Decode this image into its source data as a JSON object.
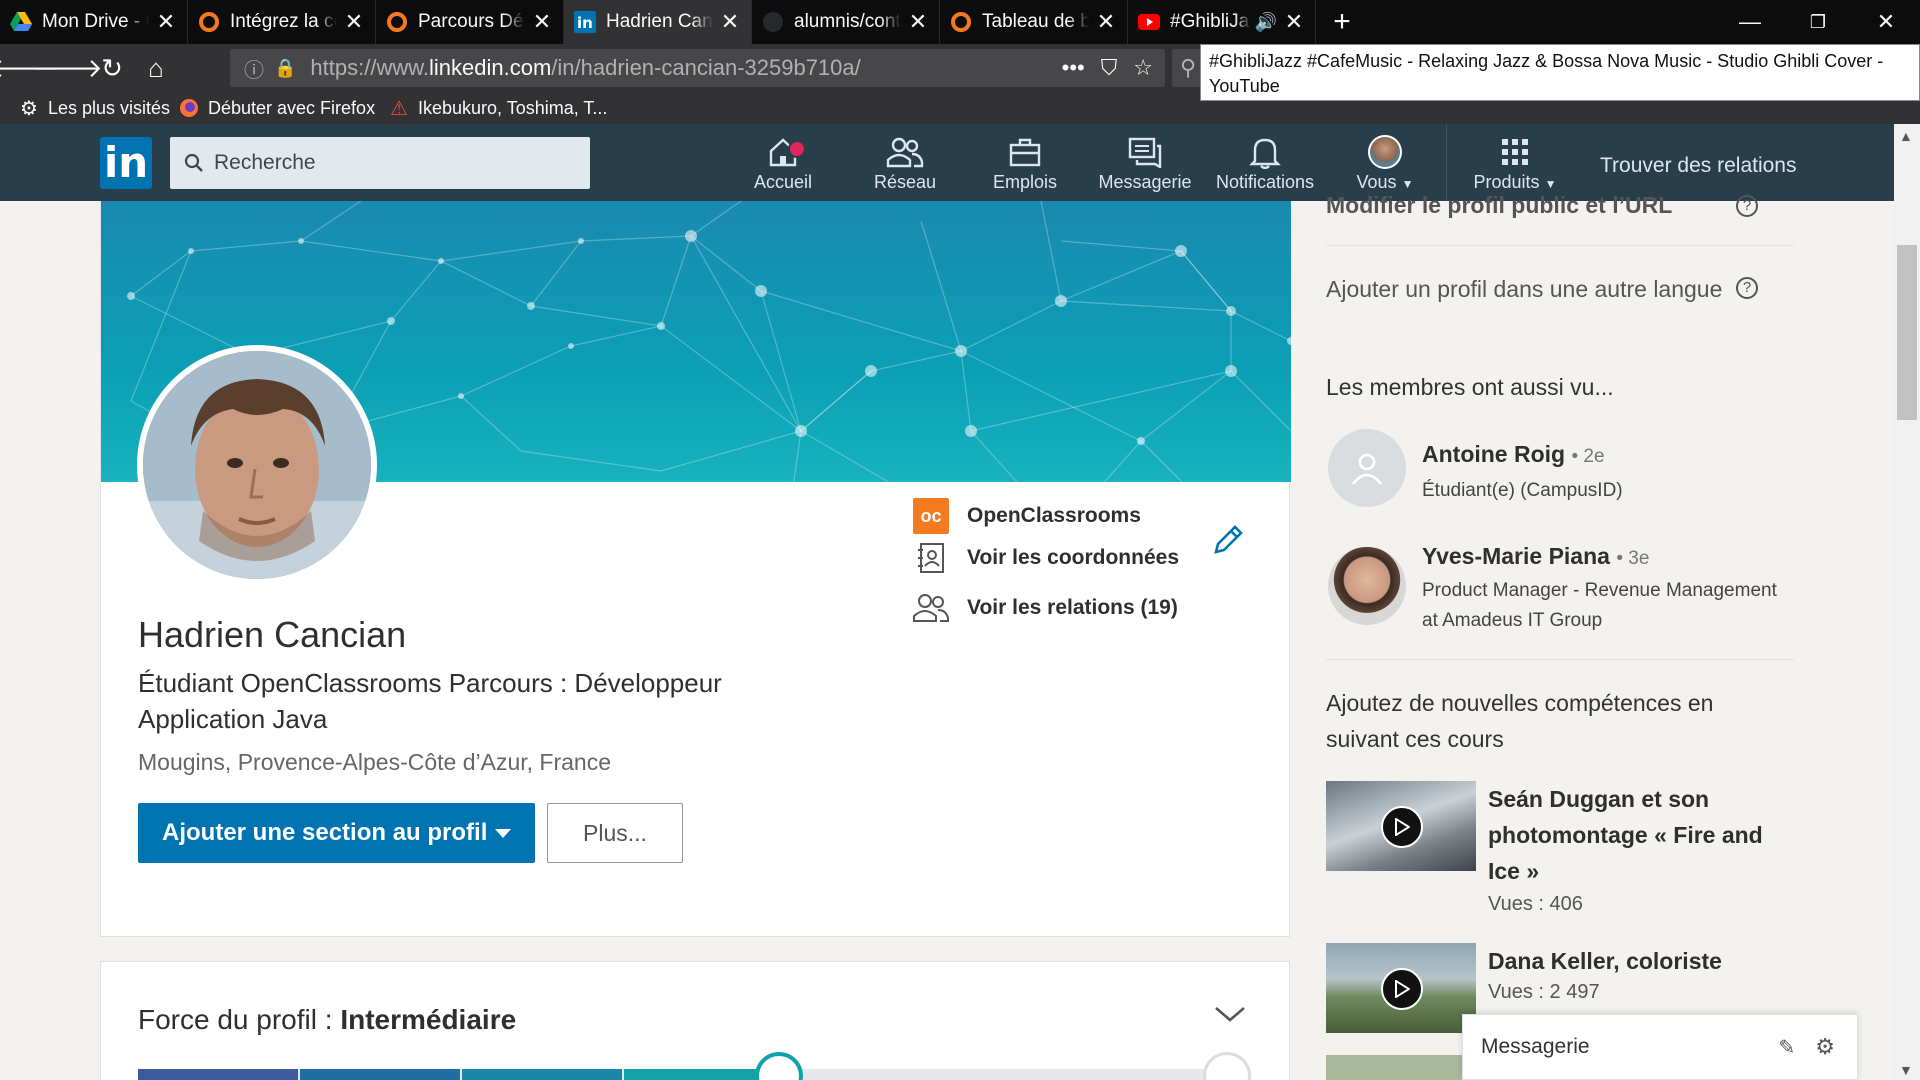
{
  "browser": {
    "tabs": [
      {
        "title": "Mon Drive - Google Drive",
        "icon": "google-drive-icon"
      },
      {
        "title": "Intégrez la communauté",
        "icon": "openclassrooms-icon"
      },
      {
        "title": "Parcours Développeur",
        "icon": "openclassrooms-icon"
      },
      {
        "title": "Hadrien Cancian | LinkedIn",
        "icon": "linkedin-icon"
      },
      {
        "title": "alumnis/content/",
        "icon": "github-icon"
      },
      {
        "title": "Tableau de bord",
        "icon": "openclassrooms-icon"
      },
      {
        "title": "#GhibliJazz #CafeMusic",
        "icon": "youtube-icon"
      }
    ],
    "url_prefix": "https://www.",
    "url_host": "linkedin.com",
    "url_path": "/in/hadrien-cancian-3259b710a/",
    "tooltip": "#GhibliJazz #CafeMusic - Relaxing Jazz & Bossa Nova Music - Studio Ghibli Cover - YouTube",
    "bookmarks": [
      {
        "label": "Les plus visités",
        "icon": "gear-icon"
      },
      {
        "label": "Débuter avec Firefox",
        "icon": "firefox-icon"
      },
      {
        "label": "Ikebukuro, Toshima, T...",
        "icon": "map-pin-icon"
      }
    ]
  },
  "linkedin": {
    "logo": "in",
    "search_placeholder": "Recherche",
    "nav": [
      {
        "label": "Accueil",
        "icon": "home-icon",
        "badge": true
      },
      {
        "label": "Réseau",
        "icon": "network-icon"
      },
      {
        "label": "Emplois",
        "icon": "briefcase-icon"
      },
      {
        "label": "Messagerie",
        "icon": "messaging-icon"
      },
      {
        "label": "Notifications",
        "icon": "bell-icon"
      },
      {
        "label": "Vous",
        "icon": "avatar-icon"
      },
      {
        "label": "Produits",
        "icon": "grid-icon"
      }
    ],
    "find_relations": "Trouver des relations"
  },
  "profile": {
    "name": "Hadrien Cancian",
    "headline": "Étudiant OpenClassrooms Parcours : Développeur Application Java",
    "location": "Mougins, Provence-Alpes-Côte d’Azur, France",
    "add_section_label": "Ajouter une section au profil",
    "more_label": "Plus...",
    "company": "OpenClassrooms",
    "company_logo_text": "oc",
    "contact_label": "Voir les coordonnées",
    "relations_label": "Voir les relations (19)"
  },
  "strength": {
    "label": "Force du profil :",
    "level": "Intermédiaire"
  },
  "rail": {
    "edit_public_url": "Modifier le profil public et l’URL",
    "add_language_profile": "Ajouter un profil dans une autre langue",
    "also_viewed_title": "Les membres ont aussi vu...",
    "people": [
      {
        "name": "Antoine Roig",
        "degree": "• 2e",
        "desc": "Étudiant(e) (CampusID)"
      },
      {
        "name": "Yves-Marie Piana",
        "degree": "• 3e",
        "desc": "Product Manager - Revenue Management at Amadeus IT Group"
      }
    ],
    "courses_title": "Ajoutez de nouvelles compétences en suivant ces cours",
    "courses": [
      {
        "title": "Seán Duggan et son photomontage « Fire and Ice »",
        "views": "Vues : 406"
      },
      {
        "title": "Dana Keller, coloriste",
        "views": "Vues : 2 497"
      }
    ]
  },
  "messaging_widget": {
    "label": "Messagerie"
  },
  "colors": {
    "linkedin_blue": "#0073b1",
    "header_bg": "#283e4a",
    "browser_bg": "#0c0c0d"
  }
}
